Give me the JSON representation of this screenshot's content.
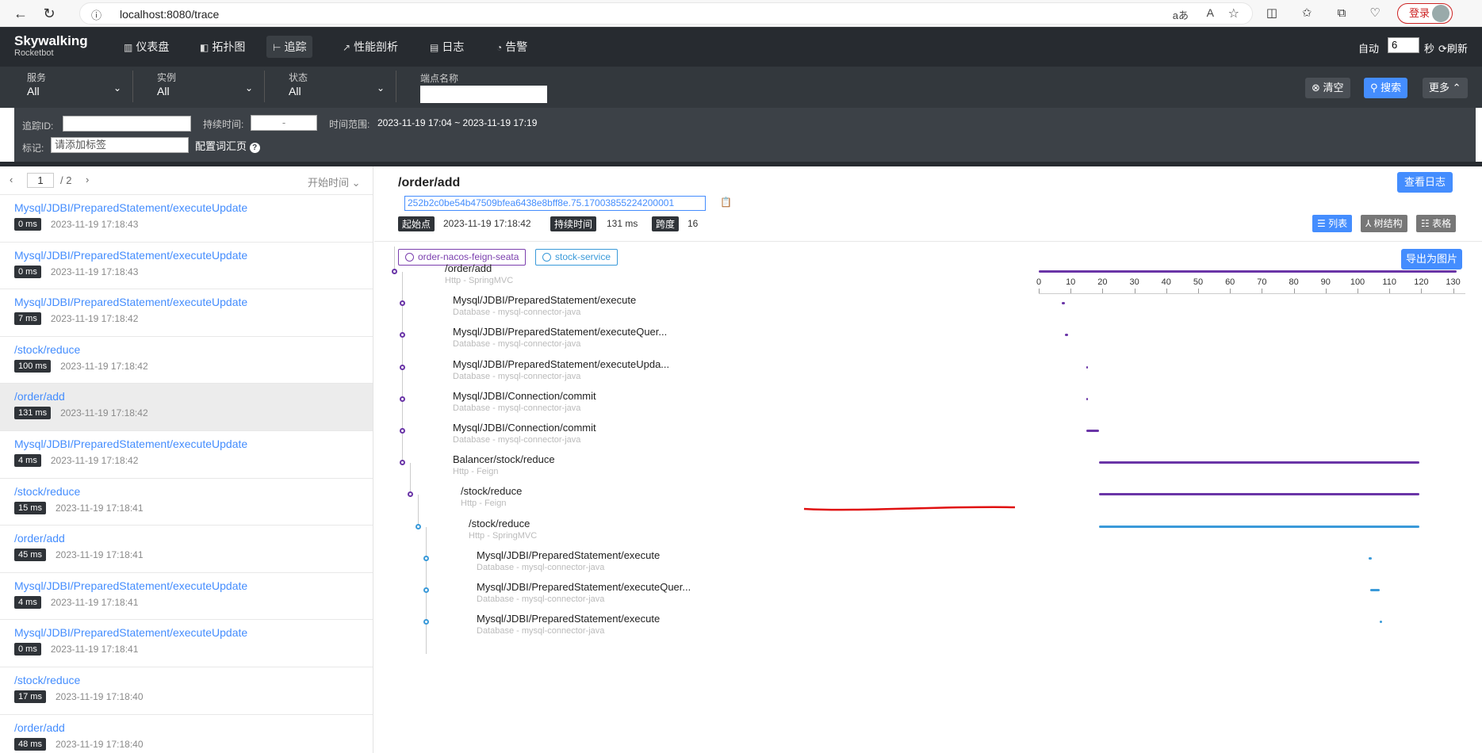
{
  "browser": {
    "url": "localhost:8080/trace",
    "login_label": "登录"
  },
  "header": {
    "logo_top": "Skywalking",
    "logo_bottom": "Rocketbot",
    "nav": [
      {
        "label": "仪表盘",
        "icon": "dashboard-icon"
      },
      {
        "label": "拓扑图",
        "icon": "topology-icon"
      },
      {
        "label": "追踪",
        "icon": "trace-icon"
      },
      {
        "label": "性能剖析",
        "icon": "profile-icon"
      },
      {
        "label": "日志",
        "icon": "log-icon"
      },
      {
        "label": "告警",
        "icon": "alarm-icon"
      }
    ],
    "auto_label": "自动",
    "auto_value": "6",
    "seconds_label": "秒",
    "refresh_label": "刷新"
  },
  "filters": {
    "service_label": "服务",
    "service_value": "All",
    "instance_label": "实例",
    "instance_value": "All",
    "status_label": "状态",
    "status_value": "All",
    "endpoint_label": "端点名称",
    "clear_label": "清空",
    "search_label": "搜索",
    "more_label": "更多"
  },
  "advanced": {
    "trace_id_label": "追踪ID:",
    "duration_label": "持续时间:",
    "duration_sep": "-",
    "time_range_label": "时间范围:",
    "time_range_value": "2023-11-19 17:04 ~ 2023-11-19 17:19",
    "tags_label": "标记:",
    "tags_placeholder": "请添加标签",
    "config_label": "配置词汇页"
  },
  "list": {
    "page": "1",
    "total": "/ 2",
    "sort_label": "开始时间",
    "traces": [
      {
        "endpoint": "Mysql/JDBI/PreparedStatement/executeUpdate",
        "duration": "0 ms",
        "time": "2023-11-19 17:18:43",
        "selected": false
      },
      {
        "endpoint": "Mysql/JDBI/PreparedStatement/executeUpdate",
        "duration": "0 ms",
        "time": "2023-11-19 17:18:43",
        "selected": false
      },
      {
        "endpoint": "Mysql/JDBI/PreparedStatement/executeUpdate",
        "duration": "7 ms",
        "time": "2023-11-19 17:18:42",
        "selected": false
      },
      {
        "endpoint": "/stock/reduce",
        "duration": "100 ms",
        "time": "2023-11-19 17:18:42",
        "selected": false
      },
      {
        "endpoint": "/order/add",
        "duration": "131 ms",
        "time": "2023-11-19 17:18:42",
        "selected": true
      },
      {
        "endpoint": "Mysql/JDBI/PreparedStatement/executeUpdate",
        "duration": "4 ms",
        "time": "2023-11-19 17:18:42",
        "selected": false
      },
      {
        "endpoint": "/stock/reduce",
        "duration": "15 ms",
        "time": "2023-11-19 17:18:41",
        "selected": false
      },
      {
        "endpoint": "/order/add",
        "duration": "45 ms",
        "time": "2023-11-19 17:18:41",
        "selected": false
      },
      {
        "endpoint": "Mysql/JDBI/PreparedStatement/executeUpdate",
        "duration": "4 ms",
        "time": "2023-11-19 17:18:41",
        "selected": false
      },
      {
        "endpoint": "Mysql/JDBI/PreparedStatement/executeUpdate",
        "duration": "0 ms",
        "time": "2023-11-19 17:18:41",
        "selected": false
      },
      {
        "endpoint": "/stock/reduce",
        "duration": "17 ms",
        "time": "2023-11-19 17:18:40",
        "selected": false
      },
      {
        "endpoint": "/order/add",
        "duration": "48 ms",
        "time": "2023-11-19 17:18:40",
        "selected": false
      }
    ]
  },
  "detail": {
    "title": "/order/add",
    "trace_id": "252b2c0be54b47509bfea6438e8bff8e.75.17003855224200001",
    "start_label": "起始点",
    "start_value": "2023-11-19 17:18:42",
    "duration_label": "持续时间",
    "duration_value": "131 ms",
    "span_label": "跨度",
    "span_value": "16",
    "view_log_label": "查看日志",
    "list_label": "列表",
    "tree_label": "树结构",
    "table_label": "表格",
    "export_label": "导出为图片",
    "services": [
      {
        "name": "order-nacos-feign-seata",
        "color": "#7b3fae"
      },
      {
        "name": "stock-service",
        "color": "#3a9ad9"
      }
    ],
    "ticks": [
      "0",
      "10",
      "20",
      "30",
      "40",
      "50",
      "60",
      "70",
      "80",
      "90",
      "100",
      "110",
      "120",
      "130"
    ],
    "spans": [
      {
        "name": "/order/add",
        "sub": "Http - SpringMVC",
        "depth": 0,
        "start": 0,
        "end": 131,
        "color": "#6a35a7"
      },
      {
        "name": "Mysql/JDBI/PreparedStatement/execute",
        "sub": "Database - mysql-connector-java",
        "depth": 1,
        "start": 7.3,
        "end": 8.2,
        "color": "#6a35a7"
      },
      {
        "name": "Mysql/JDBI/PreparedStatement/executeQuer...",
        "sub": "Database - mysql-connector-java",
        "depth": 1,
        "start": 8.3,
        "end": 9.2,
        "color": "#6a35a7"
      },
      {
        "name": "Mysql/JDBI/PreparedStatement/executeUpda...",
        "sub": "Database - mysql-connector-java",
        "depth": 1,
        "start": 15,
        "end": 15.3,
        "color": "#6a35a7"
      },
      {
        "name": "Mysql/JDBI/Connection/commit",
        "sub": "Database - mysql-connector-java",
        "depth": 1,
        "start": 15,
        "end": 15.3,
        "color": "#6a35a7"
      },
      {
        "name": "Mysql/JDBI/Connection/commit",
        "sub": "Database - mysql-connector-java",
        "depth": 1,
        "start": 15,
        "end": 19,
        "color": "#6a35a7"
      },
      {
        "name": "Balancer/stock/reduce",
        "sub": "Http - Feign",
        "depth": 1,
        "start": 19,
        "end": 119.5,
        "color": "#6a35a7"
      },
      {
        "name": "/stock/reduce",
        "sub": "Http - Feign",
        "depth": 2,
        "start": 19,
        "end": 119.5,
        "color": "#6a35a7"
      },
      {
        "name": "/stock/reduce",
        "sub": "Http - SpringMVC",
        "depth": 3,
        "start": 19,
        "end": 119.5,
        "color": "#3a9ad9"
      },
      {
        "name": "Mysql/JDBI/PreparedStatement/execute",
        "sub": "Database - mysql-connector-java",
        "depth": 4,
        "start": 103.6,
        "end": 104.4,
        "color": "#3a9ad9"
      },
      {
        "name": "Mysql/JDBI/PreparedStatement/executeQuer...",
        "sub": "Database - mysql-connector-java",
        "depth": 4,
        "start": 104,
        "end": 107,
        "color": "#3a9ad9"
      },
      {
        "name": "Mysql/JDBI/PreparedStatement/execute",
        "sub": "Database - mysql-connector-java",
        "depth": 4,
        "start": 107,
        "end": 107.6,
        "color": "#3a9ad9"
      }
    ]
  }
}
